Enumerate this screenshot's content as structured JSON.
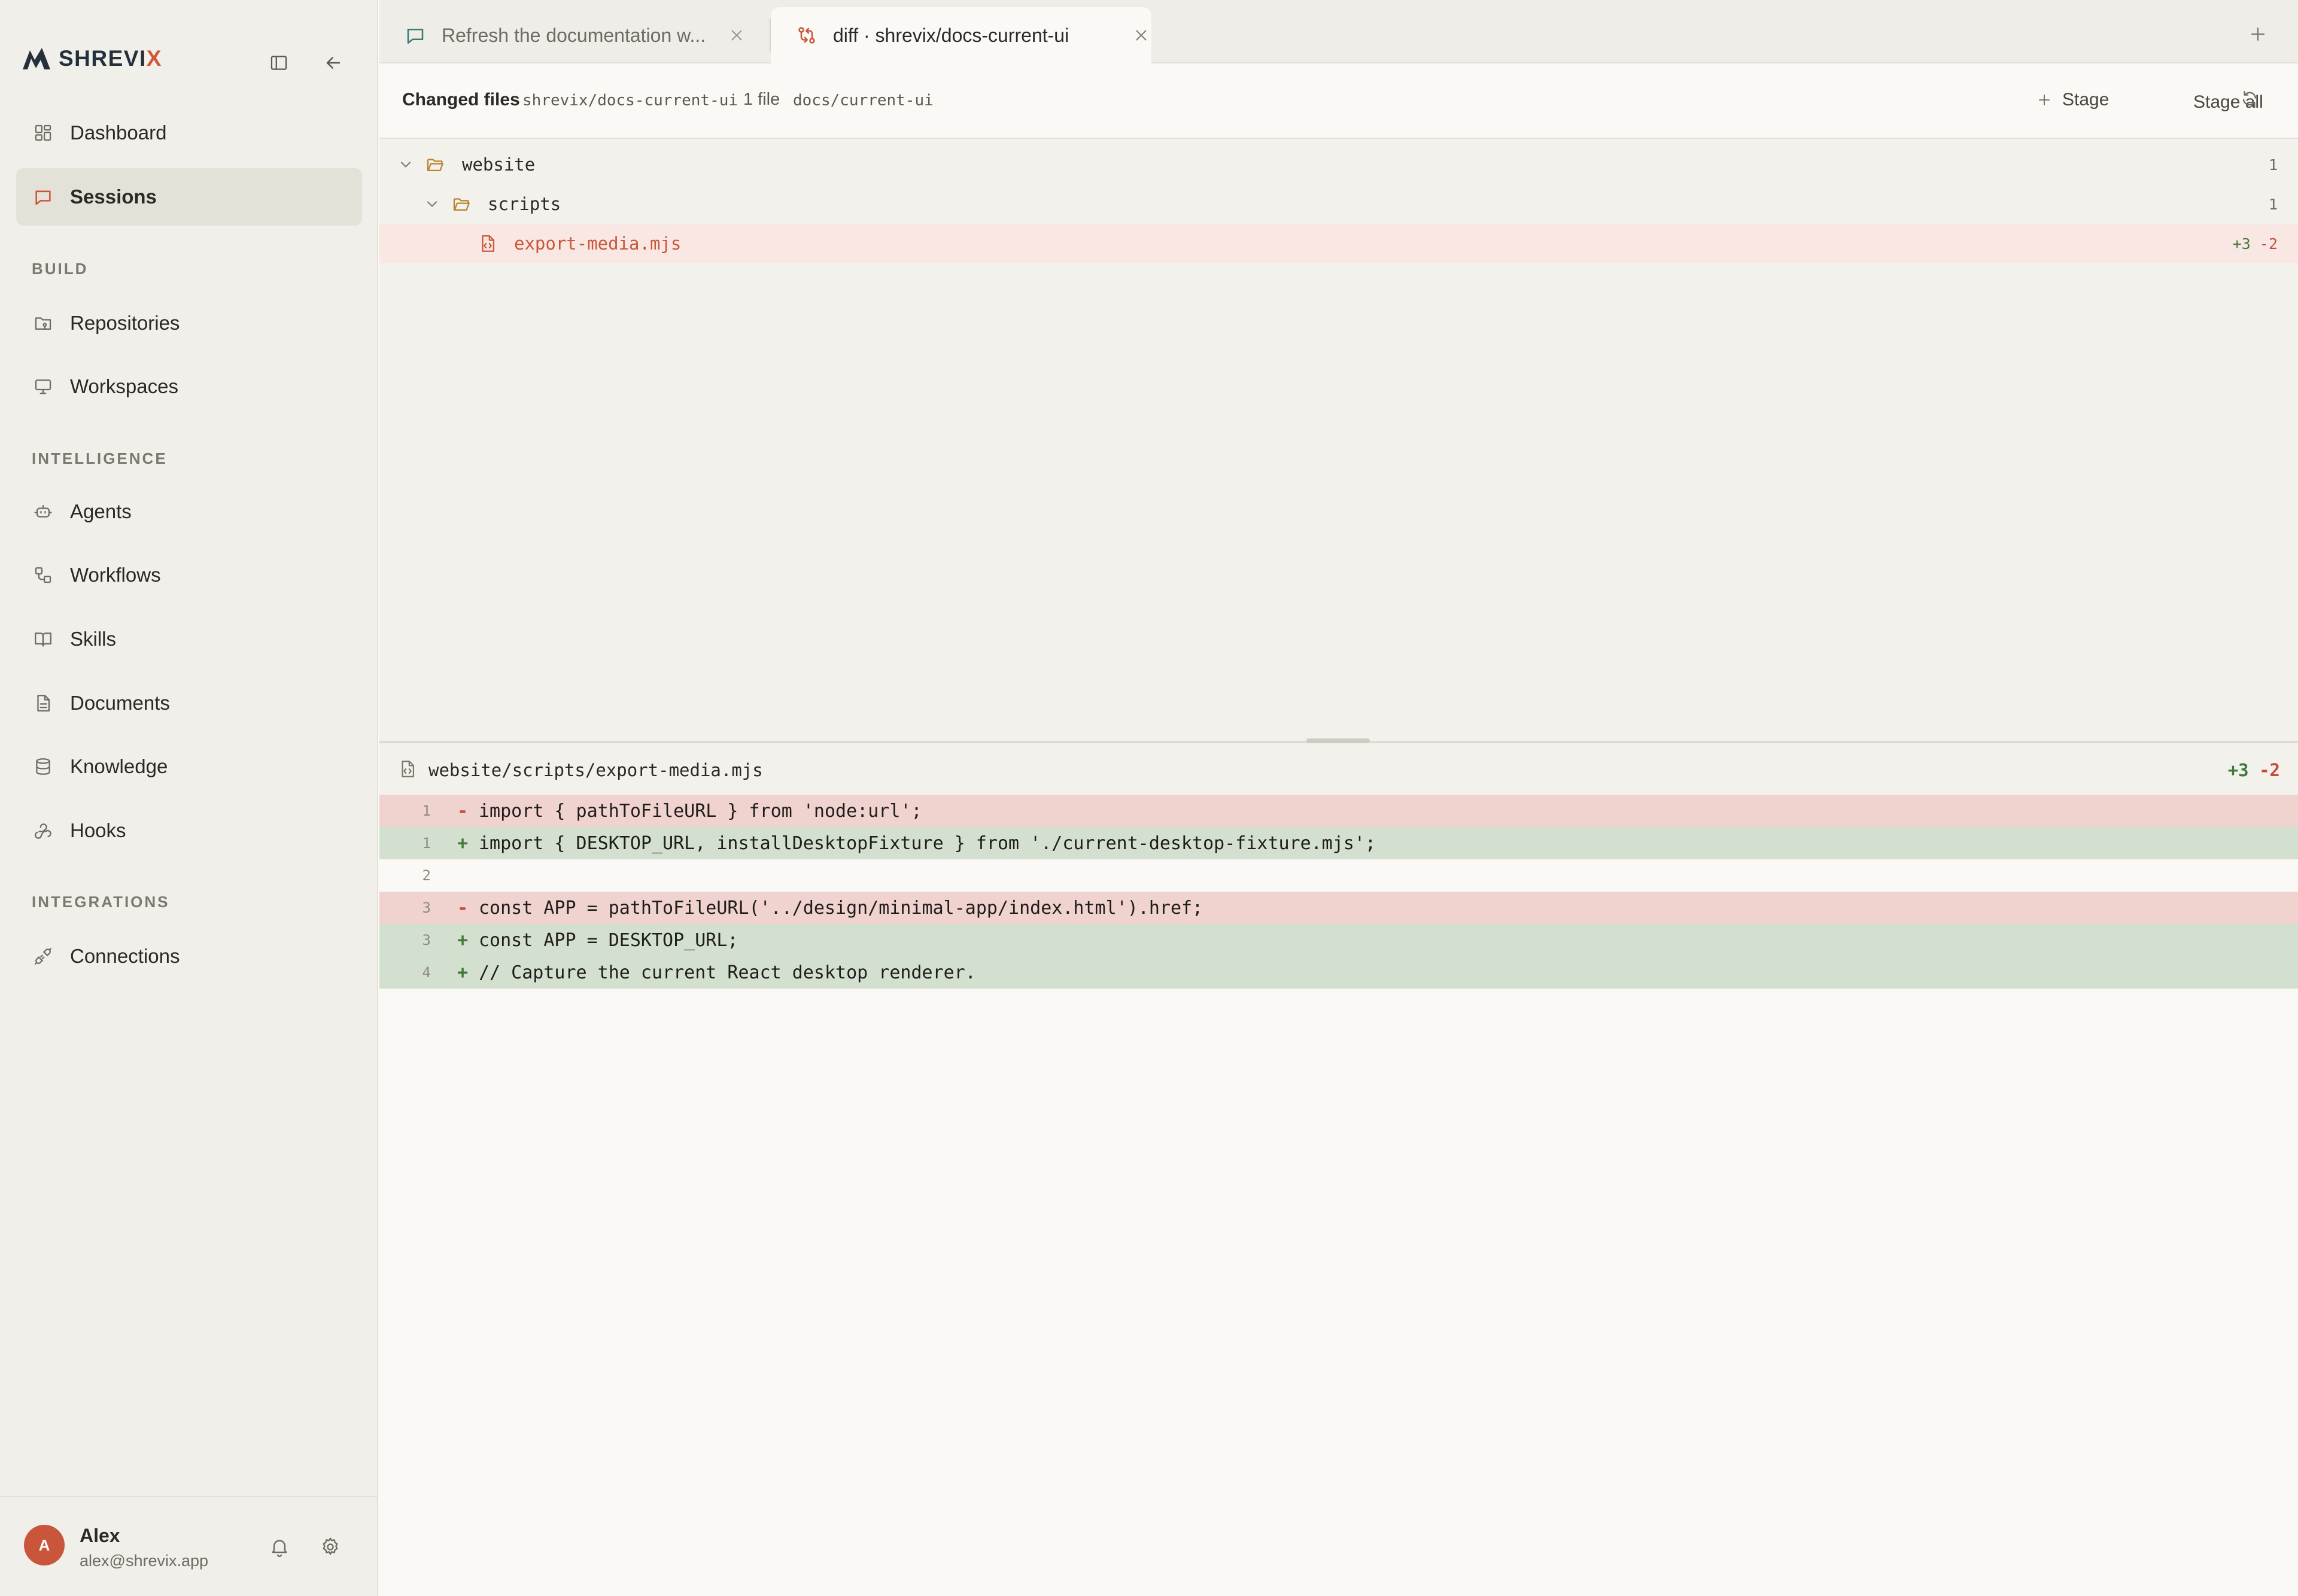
{
  "sidebar": {
    "logo": {
      "text_main": "SHREVI",
      "text_accent": "X"
    },
    "nav_top": [
      {
        "label": "Dashboard",
        "icon": "dashboard-icon"
      },
      {
        "label": "Sessions",
        "icon": "chat-icon",
        "active": true
      }
    ],
    "sections": [
      {
        "label": "BUILD",
        "items": [
          {
            "label": "Repositories",
            "icon": "folder-git-icon"
          },
          {
            "label": "Workspaces",
            "icon": "monitor-icon"
          }
        ]
      },
      {
        "label": "INTELLIGENCE",
        "items": [
          {
            "label": "Agents",
            "icon": "bot-icon"
          },
          {
            "label": "Workflows",
            "icon": "workflow-icon"
          },
          {
            "label": "Skills",
            "icon": "book-icon"
          },
          {
            "label": "Documents",
            "icon": "file-text-icon"
          },
          {
            "label": "Knowledge",
            "icon": "database-icon"
          },
          {
            "label": "Hooks",
            "icon": "webhook-icon"
          }
        ]
      },
      {
        "label": "INTEGRATIONS",
        "items": [
          {
            "label": "Connections",
            "icon": "plug-icon"
          }
        ]
      }
    ],
    "user": {
      "initial": "A",
      "name": "Alex",
      "email": "alex@shrevix.app"
    }
  },
  "tabs": [
    {
      "label": "Refresh the documentation w...",
      "icon": "chat-icon",
      "active": false
    },
    {
      "label": "diff · shrevix/docs-current-ui",
      "icon": "git-compare-icon",
      "active": true
    }
  ],
  "changed_files": {
    "title": "Changed files",
    "repo": "shrevix/docs-current-ui",
    "count": "1 file",
    "branch": "docs/current-ui",
    "stage_label": "Stage",
    "stage_all_label": "Stage all"
  },
  "tree": [
    {
      "name": "website",
      "type": "folder",
      "count": "1"
    },
    {
      "name": "scripts",
      "type": "folder",
      "count": "1"
    },
    {
      "name": "export-media.mjs",
      "type": "file",
      "additions": "+3",
      "deletions": "-2"
    }
  ],
  "diff": {
    "path": "website/scripts/export-media.mjs",
    "additions": "+3",
    "deletions": "-2",
    "lines": [
      {
        "no": "1",
        "kind": "del",
        "sign": "-",
        "code": "import { pathToFileURL } from 'node:url';"
      },
      {
        "no": "1",
        "kind": "add",
        "sign": "+",
        "code": "import { DESKTOP_URL, installDesktopFixture } from './current-desktop-fixture.mjs';"
      },
      {
        "no": "2",
        "kind": "ctx",
        "sign": "",
        "code": ""
      },
      {
        "no": "3",
        "kind": "del",
        "sign": "-",
        "code": "const APP = pathToFileURL('../design/minimal-app/index.html').href;"
      },
      {
        "no": "3",
        "kind": "add",
        "sign": "+",
        "code": "const APP = DESKTOP_URL;"
      },
      {
        "no": "4",
        "kind": "add",
        "sign": "+",
        "code": "// Capture the current React desktop renderer."
      }
    ]
  },
  "colors": {
    "accent": "#c9563a",
    "active_nav_bg": "#e4e1d8",
    "deleted_line_bg": "#f0d3cf",
    "added_line_bg": "#d4e0cf"
  }
}
